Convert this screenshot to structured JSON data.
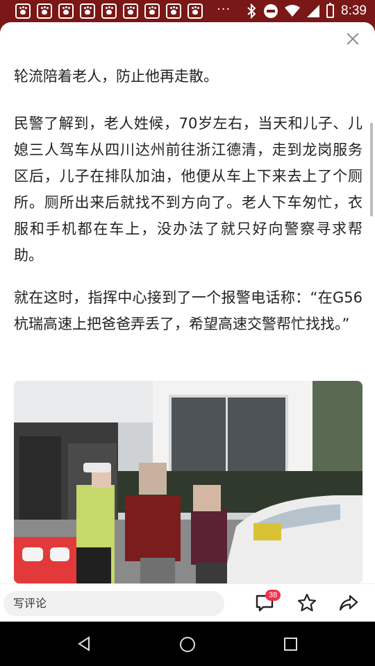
{
  "status_bar": {
    "time": "8:39",
    "more": "···",
    "app_icons": [
      "baidu-paw-icon",
      "baidu-paw-icon",
      "baidu-paw-icon",
      "baidu-paw-icon",
      "baidu-paw-icon",
      "baidu-paw-icon",
      "baidu-paw-icon",
      "baidu-paw-icon",
      "baidu-paw-icon"
    ]
  },
  "article": {
    "paragraphs": [
      "轮流陪着老人，防止他再走散。",
      "民警了解到，老人姓候，70岁左右，当天和儿子、儿媳三人驾车从四川达州前往浙江德清，走到龙岗服务区后，儿子在排队加油，他便从车上下来去上了个厕所。厕所出来后就找不到方向了。老人下车匆忙，衣服和手机都在车上，没办法了就只好向警察寻求帮助。",
      "就在这时，指挥中心接到了一个报警电话称：“在G56杭瑞高速上把爸爸弄丢了，希望高速交警帮忙找找。”"
    ]
  },
  "bottom_bar": {
    "comment_placeholder": "写评论",
    "comment_count": "38"
  },
  "colors": {
    "status_bar_bg": "#7a1717",
    "badge_red": "#f0324a"
  }
}
